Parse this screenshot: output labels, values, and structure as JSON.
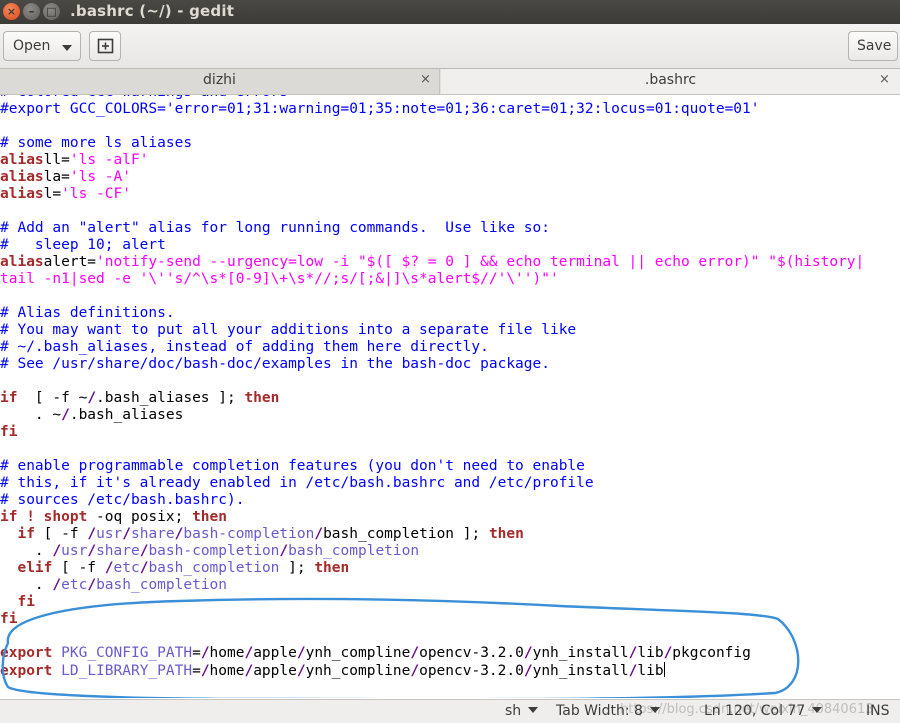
{
  "window": {
    "title": ".bashrc (~/) - gedit",
    "close_glyph": "×",
    "minimize_glyph": "–",
    "maximize_glyph": "□"
  },
  "header": {
    "open_label": "Open",
    "save_label": "Save",
    "new_tab_icon": "new-tab-icon"
  },
  "tabs": [
    {
      "label": "dizhi",
      "close": "×",
      "active": false
    },
    {
      "label": ".bashrc",
      "close": "×",
      "active": true
    }
  ],
  "colors": {
    "comment": "#0000ff",
    "keyword": "#a52a2a",
    "string": "#ff00ff",
    "path": "#6a5acd",
    "annotation": "#3a8fd8",
    "titlebar": "#3c3b37"
  },
  "code_lines": [
    [
      [
        "cm",
        "# colored GCC warnings and errors"
      ]
    ],
    [
      [
        "cm",
        "#export GCC_COLORS='error=01;31:warning=01;35:note=01;36:caret=01;32:locus=01:quote=01'"
      ]
    ],
    [],
    [
      [
        "cm",
        "# some more ls aliases"
      ]
    ],
    [
      [
        "kw",
        "alias"
      ],
      [
        "",
        "ll="
      ],
      [
        "st",
        "'ls -alF'"
      ]
    ],
    [
      [
        "kw",
        "alias"
      ],
      [
        "",
        "la="
      ],
      [
        "st",
        "'ls -A'"
      ]
    ],
    [
      [
        "kw",
        "alias"
      ],
      [
        "",
        "l="
      ],
      [
        "st",
        "'ls -CF'"
      ]
    ],
    [],
    [
      [
        "cm",
        "# Add an \"alert\" alias for long running commands.  Use like so:"
      ]
    ],
    [
      [
        "cm",
        "#   sleep 10; alert"
      ]
    ],
    [
      [
        "kw",
        "alias"
      ],
      [
        "",
        "alert="
      ],
      [
        "st",
        "'notify-send --urgency=low -i \"$([ $? = 0 ] && echo terminal || echo error)\" \"$(history|"
      ]
    ],
    [
      [
        "st",
        "tail -n1|sed -e '\\''s/^\\s*[0-9]\\+\\s*//;s/[;&|]\\s*alert$//'\\'')\"'"
      ]
    ],
    [],
    [
      [
        "cm",
        "# Alias definitions."
      ]
    ],
    [
      [
        "cm",
        "# You may want to put all your additions into a separate file like"
      ]
    ],
    [
      [
        "cm",
        "# ~/.bash_aliases, instead of adding them here directly."
      ]
    ],
    [
      [
        "cm",
        "# See /usr/share/doc/bash-doc/examples in the bash-doc package."
      ]
    ],
    [],
    [
      [
        "kw",
        "if"
      ],
      [
        "",
        "  [ -f ~"
      ],
      [
        "sl",
        "/"
      ],
      [
        "",
        ".bash_aliases ]; "
      ],
      [
        "kw",
        "then"
      ]
    ],
    [
      [
        "",
        "    . ~"
      ],
      [
        "sl",
        "/"
      ],
      [
        "",
        ".bash_aliases"
      ]
    ],
    [
      [
        "kw",
        "fi"
      ]
    ],
    [],
    [
      [
        "cm",
        "# enable programmable completion features (you don't need to enable"
      ]
    ],
    [
      [
        "cm",
        "# this, if it's already enabled in /etc/bash.bashrc and /etc/profile"
      ]
    ],
    [
      [
        "cm",
        "# sources /etc/bash.bashrc)."
      ]
    ],
    [
      [
        "kw",
        "if"
      ],
      [
        "",
        ""
      ],
      [
        "kw",
        " ! shopt"
      ],
      [
        "",
        " -oq posix; "
      ],
      [
        "kw",
        "then"
      ]
    ],
    [
      [
        "",
        "  "
      ],
      [
        "kw",
        "if"
      ],
      [
        "",
        " [ -f "
      ],
      [
        "sl",
        "/"
      ],
      [
        "pa",
        "usr"
      ],
      [
        "sl",
        "/"
      ],
      [
        "pa",
        "share"
      ],
      [
        "sl",
        "/"
      ],
      [
        "pa",
        "bash-completion"
      ],
      [
        "sl",
        "/"
      ],
      [
        "",
        "bash_completion ]; "
      ],
      [
        "kw",
        "then"
      ]
    ],
    [
      [
        "",
        "    . "
      ],
      [
        "sl",
        "/"
      ],
      [
        "pa",
        "usr"
      ],
      [
        "sl",
        "/"
      ],
      [
        "pa",
        "share"
      ],
      [
        "sl",
        "/"
      ],
      [
        "pa",
        "bash-completion"
      ],
      [
        "sl",
        "/"
      ],
      [
        "pa",
        "bash_completion"
      ]
    ],
    [
      [
        "",
        "  "
      ],
      [
        "kw",
        "elif"
      ],
      [
        "",
        " [ -f "
      ],
      [
        "sl",
        "/"
      ],
      [
        "pa",
        "etc"
      ],
      [
        "sl",
        "/"
      ],
      [
        "pa",
        "bash_completion"
      ],
      [
        "",
        " ]; "
      ],
      [
        "kw",
        "then"
      ]
    ],
    [
      [
        "",
        "    . "
      ],
      [
        "sl",
        "/"
      ],
      [
        "pa",
        "etc"
      ],
      [
        "sl",
        "/"
      ],
      [
        "pa",
        "bash_completion"
      ]
    ],
    [
      [
        "",
        "  "
      ],
      [
        "kw",
        "fi"
      ]
    ],
    [
      [
        "kw",
        "fi"
      ]
    ],
    [],
    [
      [
        "kw",
        "export"
      ],
      [
        "",
        " "
      ],
      [
        "pa",
        "PKG_CONFIG_PATH"
      ],
      [
        "",
        "="
      ],
      [
        "sl",
        "/"
      ],
      [
        "",
        "home"
      ],
      [
        "sl",
        "/"
      ],
      [
        "",
        "apple"
      ],
      [
        "sl",
        "/"
      ],
      [
        "",
        "ynh_compline"
      ],
      [
        "sl",
        "/"
      ],
      [
        "",
        "opencv-3.2.0"
      ],
      [
        "sl",
        "/"
      ],
      [
        "",
        "ynh_install"
      ],
      [
        "sl",
        "/"
      ],
      [
        "",
        "lib"
      ],
      [
        "sl",
        "/"
      ],
      [
        "",
        "pkgconfig"
      ]
    ],
    [
      [
        "kw",
        "export"
      ],
      [
        "",
        " "
      ],
      [
        "pa",
        "LD_LIBRARY_PATH"
      ],
      [
        "",
        "="
      ],
      [
        "sl",
        "/"
      ],
      [
        "",
        "home"
      ],
      [
        "sl",
        "/"
      ],
      [
        "",
        "apple"
      ],
      [
        "sl",
        "/"
      ],
      [
        "",
        "ynh_compline"
      ],
      [
        "sl",
        "/"
      ],
      [
        "",
        "opencv-3.2.0"
      ],
      [
        "sl",
        "/"
      ],
      [
        "",
        "ynh_install"
      ],
      [
        "sl",
        "/"
      ],
      [
        "",
        "lib"
      ],
      [
        "cursor",
        ""
      ]
    ]
  ],
  "status": {
    "language": "sh",
    "tab_width": "Tab Width: 8",
    "position": "Ln 120, Col 77",
    "mode": "INS",
    "watermark": "https://blog.csdn.net/weixin_40840613"
  }
}
